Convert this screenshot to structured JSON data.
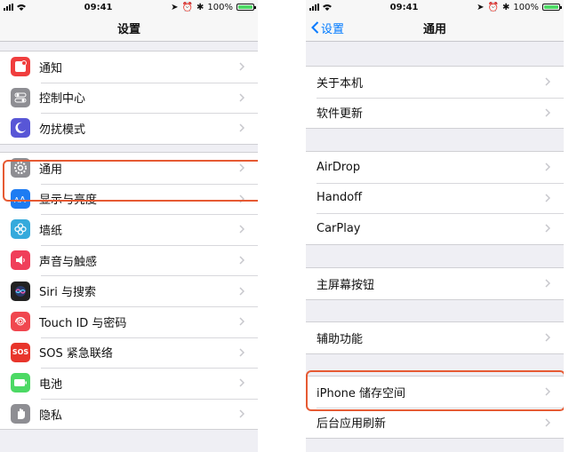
{
  "left_screen": {
    "status": {
      "time": "09:41",
      "battery": "100%",
      "battery_level": 1.0
    },
    "title": "设置",
    "groups": [
      [
        {
          "label": "通知",
          "icon": "notifications-icon",
          "color": "#f03e3e"
        },
        {
          "label": "控制中心",
          "icon": "control-center-icon",
          "color": "#8e8e93"
        },
        {
          "label": "勿扰模式",
          "icon": "moon-icon",
          "color": "#5856d6"
        }
      ],
      [
        {
          "label": "通用",
          "icon": "gear-icon",
          "color": "#8e8e93"
        },
        {
          "label": "显示与亮度",
          "icon": "display-brightness-icon",
          "color": "#1e7cf2"
        },
        {
          "label": "墙纸",
          "icon": "wallpaper-icon",
          "color": "#35aadc"
        },
        {
          "label": "声音与触感",
          "icon": "speaker-icon",
          "color": "#f03e5a"
        },
        {
          "label": "Siri 与搜索",
          "icon": "siri-icon",
          "color": "#222222"
        },
        {
          "label": "Touch ID 与密码",
          "icon": "fingerprint-icon",
          "color": "#f0474f"
        },
        {
          "label": "SOS 紧急联络",
          "icon": "sos-icon",
          "color": "#e8352b",
          "icon_text": "SOS"
        },
        {
          "label": "电池",
          "icon": "battery-icon",
          "color": "#4cd964"
        },
        {
          "label": "隐私",
          "icon": "hand-icon",
          "color": "#8e8e93"
        }
      ]
    ]
  },
  "right_screen": {
    "status": {
      "time": "09:41",
      "battery": "100%",
      "battery_level": 1.0
    },
    "back_label": "设置",
    "title": "通用",
    "groups": [
      [
        {
          "label": "关于本机"
        },
        {
          "label": "软件更新"
        }
      ],
      [
        {
          "label": "AirDrop"
        },
        {
          "label": "Handoff"
        },
        {
          "label": "CarPlay"
        }
      ],
      [
        {
          "label": "主屏幕按钮"
        }
      ],
      [
        {
          "label": "辅助功能"
        }
      ],
      [
        {
          "label": "iPhone 储存空间"
        },
        {
          "label": "后台应用刷新"
        }
      ]
    ]
  },
  "colors": {
    "highlight": "#e65a33",
    "ios_blue": "#007aff"
  }
}
